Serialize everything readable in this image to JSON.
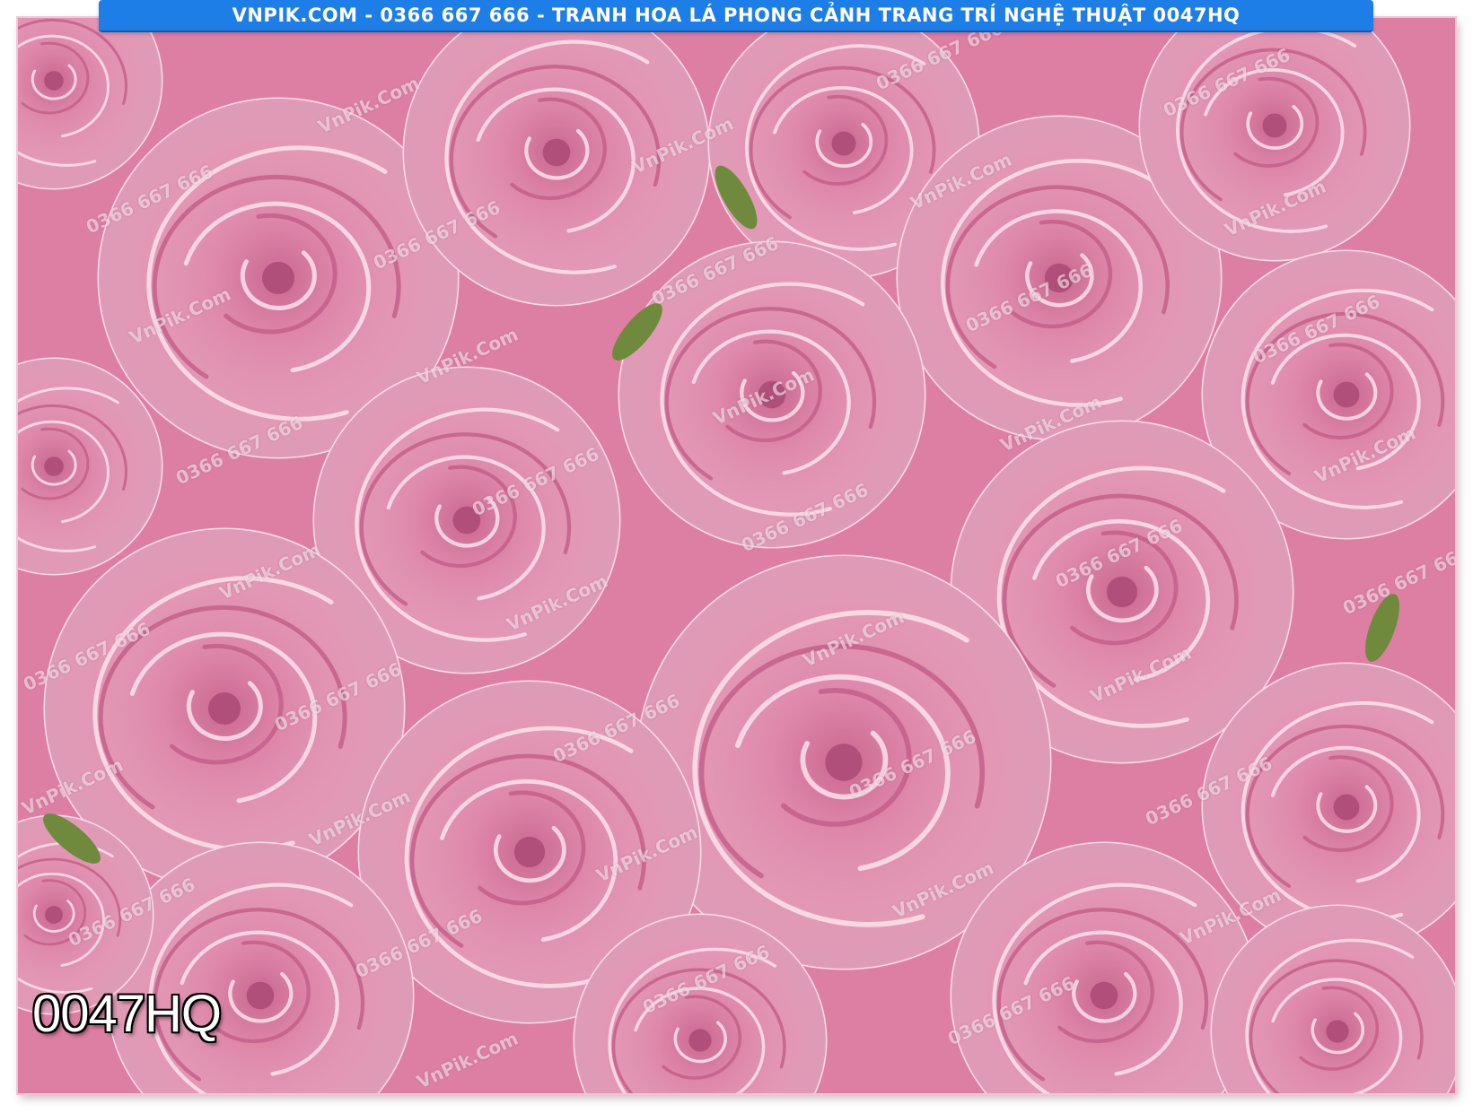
{
  "banner": {
    "text": "VNPIK.COM - 0366 667 666 - TRANH HOA LÁ PHONG CẢNH TRANG TRÍ NGHỆ THUẬT 0047HQ",
    "background_color": "#1e7ee8"
  },
  "product_code": "0047HQ",
  "photo": {
    "subject": "pink-roses",
    "dominant_color": "#ec9ab8"
  },
  "watermarks": {
    "site": "VnPik.Com",
    "phone": "0366 667 666"
  }
}
